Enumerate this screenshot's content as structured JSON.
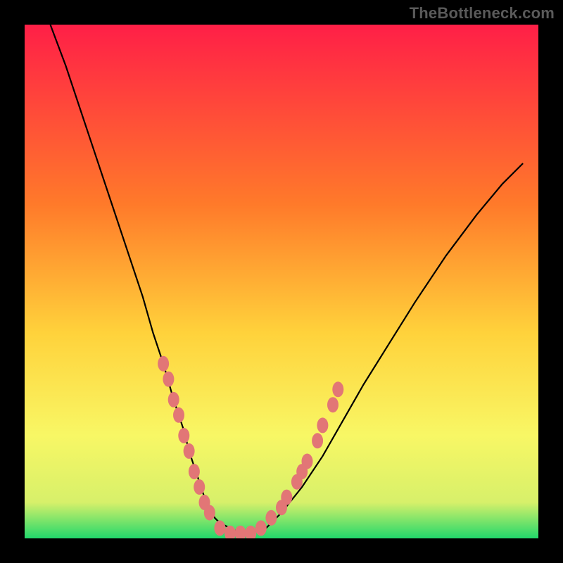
{
  "watermark": "TheBottleneck.com",
  "colors": {
    "black": "#000000",
    "curve": "#000000",
    "marker": "#e27676",
    "grad_top": "#ff1f47",
    "grad_mid1": "#ff7a2a",
    "grad_mid2": "#ffd23b",
    "grad_mid3": "#f8f765",
    "grad_mid4": "#d7f06a",
    "grad_bot": "#22d86b"
  },
  "chart_data": {
    "type": "line",
    "title": "",
    "xlabel": "",
    "ylabel": "",
    "xlim": [
      0,
      100
    ],
    "ylim": [
      0,
      100
    ],
    "series": [
      {
        "name": "bottleneck-curve",
        "x": [
          5,
          8,
          11,
          14,
          17,
          20,
          23,
          25,
          27,
          29,
          31,
          32,
          33,
          34,
          35,
          36,
          37,
          38,
          40,
          42,
          44,
          47,
          50,
          54,
          58,
          62,
          66,
          71,
          76,
          82,
          88,
          93,
          97
        ],
        "y": [
          100,
          92,
          83,
          74,
          65,
          56,
          47,
          40,
          34,
          27,
          21,
          17,
          14,
          11,
          8,
          6,
          4,
          3,
          2,
          1,
          1,
          2,
          5,
          10,
          16,
          23,
          30,
          38,
          46,
          55,
          63,
          69,
          73
        ]
      }
    ],
    "markers": [
      {
        "x": 27,
        "y": 34
      },
      {
        "x": 28,
        "y": 31
      },
      {
        "x": 29,
        "y": 27
      },
      {
        "x": 30,
        "y": 24
      },
      {
        "x": 31,
        "y": 20
      },
      {
        "x": 32,
        "y": 17
      },
      {
        "x": 33,
        "y": 13
      },
      {
        "x": 34,
        "y": 10
      },
      {
        "x": 35,
        "y": 7
      },
      {
        "x": 36,
        "y": 5
      },
      {
        "x": 38,
        "y": 2
      },
      {
        "x": 40,
        "y": 1
      },
      {
        "x": 42,
        "y": 1
      },
      {
        "x": 44,
        "y": 1
      },
      {
        "x": 46,
        "y": 2
      },
      {
        "x": 48,
        "y": 4
      },
      {
        "x": 50,
        "y": 6
      },
      {
        "x": 51,
        "y": 8
      },
      {
        "x": 53,
        "y": 11
      },
      {
        "x": 54,
        "y": 13
      },
      {
        "x": 55,
        "y": 15
      },
      {
        "x": 57,
        "y": 19
      },
      {
        "x": 58,
        "y": 22
      },
      {
        "x": 60,
        "y": 26
      },
      {
        "x": 61,
        "y": 29
      }
    ],
    "bands": [
      {
        "from_y": 0,
        "to_y": 3,
        "color": "#22d86b"
      },
      {
        "from_y": 3,
        "to_y": 10,
        "color": "#d7f06a"
      },
      {
        "from_y": 10,
        "to_y": 20,
        "color": "#f8f765"
      }
    ]
  }
}
